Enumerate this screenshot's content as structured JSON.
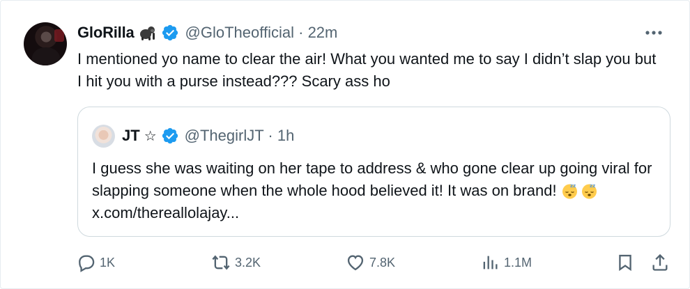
{
  "tweet": {
    "author_name": "GloRilla",
    "author_emoji": "gorilla-emoji",
    "author_handle": "@GloTheofficial",
    "separator": "·",
    "time": "22m",
    "text": "I mentioned yo name to clear the air! What you wanted me to say I didn’t slap you but I hit you with a purse instead??? Scary ass ho"
  },
  "quote": {
    "author_name": "JT",
    "star": "☆",
    "author_handle": "@ThegirlJT",
    "separator": "·",
    "time": "1h",
    "text": "I guess she was waiting on her tape to address & who gone clear up going viral for slapping someone when the whole hood believed it! It was on brand!",
    "emojis": [
      "sleepy-face-emoji",
      "sleepy-face-emoji"
    ],
    "link": "x.com/thereallolajay..."
  },
  "actions": {
    "replies": "1K",
    "reposts": "3.2K",
    "likes": "7.8K",
    "views": "1.1M"
  },
  "colors": {
    "text": "#0f1419",
    "muted": "#536471",
    "verified": "#1d9bf0",
    "border": "#cfd9de"
  },
  "icons": [
    "more-icon",
    "verified-icon",
    "reply-icon",
    "repost-icon",
    "like-icon",
    "views-icon",
    "bookmark-icon",
    "share-icon"
  ]
}
